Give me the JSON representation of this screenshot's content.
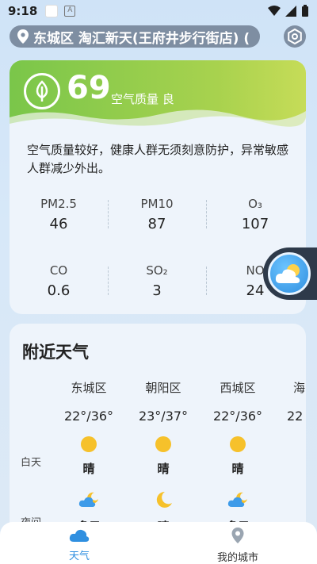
{
  "status": {
    "time": "9:18"
  },
  "location": {
    "text": "东城区 淘汇新天(王府井步行街店) ("
  },
  "air_quality": {
    "value": "69",
    "label": "空气质量 良",
    "description": "空气质量较好，健康人群无须刻意防护，异常敏感人群减少外出。",
    "pollutants": [
      {
        "name": "PM2.5",
        "value": "46"
      },
      {
        "name": "PM10",
        "value": "87"
      },
      {
        "name": "O₃",
        "value": "107"
      },
      {
        "name": "CO",
        "value": "0.6"
      },
      {
        "name": "SO₂",
        "value": "3"
      },
      {
        "name": "NO",
        "value": "24"
      }
    ],
    "colors": {
      "good": "#7ac64a"
    }
  },
  "nearby": {
    "title": "附近天气",
    "day_label": "白天",
    "night_label": "夜间",
    "districts": [
      {
        "name": "东城区",
        "temp": "22°/36°",
        "day_cond": "晴",
        "night_cond": "多云",
        "night_icon": "cloud-moon-icon"
      },
      {
        "name": "朝阳区",
        "temp": "23°/37°",
        "day_cond": "晴",
        "night_cond": "晴",
        "night_icon": "moon-icon"
      },
      {
        "name": "西城区",
        "temp": "22°/36°",
        "day_cond": "晴",
        "night_cond": "多云",
        "night_icon": "cloud-moon-icon"
      },
      {
        "name": "海",
        "temp": "22",
        "day_cond": "",
        "night_cond": "",
        "night_icon": "cloud-moon-icon"
      }
    ]
  },
  "nav": {
    "weather": "天气",
    "my_city": "我的城市",
    "active_color": "#2f8fe0"
  }
}
